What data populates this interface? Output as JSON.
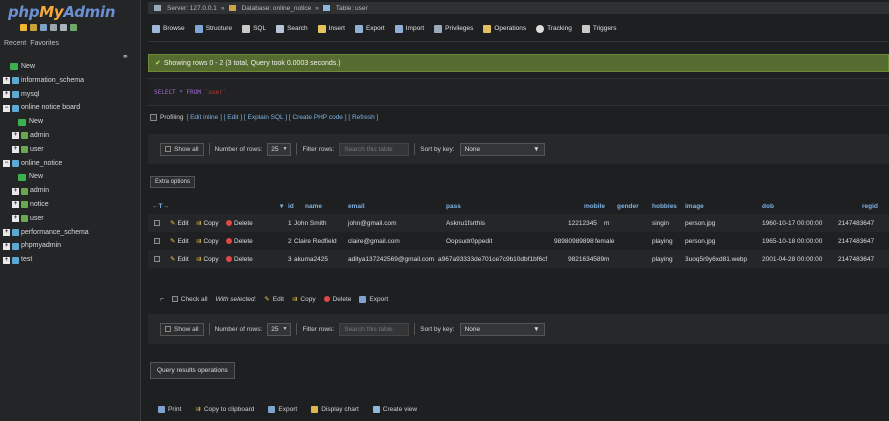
{
  "sidebar": {
    "logo": {
      "php": "php",
      "my": "My",
      "admin": "Admin"
    },
    "tabs": [
      "Recent",
      "Favorites"
    ],
    "collapse_icon": "chain-link-icon",
    "tree": [
      {
        "label": "New",
        "type": "new",
        "level": 0
      },
      {
        "label": "information_schema",
        "type": "db",
        "level": 0
      },
      {
        "label": "mysql",
        "type": "db",
        "level": 0
      },
      {
        "label": "online notice board",
        "type": "db",
        "level": 0
      },
      {
        "label": "New",
        "type": "new",
        "level": 1
      },
      {
        "label": "admin",
        "type": "table",
        "level": 1
      },
      {
        "label": "user",
        "type": "table",
        "level": 1
      },
      {
        "label": "online_notice",
        "type": "db",
        "level": 0
      },
      {
        "label": "New",
        "type": "new",
        "level": 1
      },
      {
        "label": "admin",
        "type": "table",
        "level": 1
      },
      {
        "label": "notice",
        "type": "table",
        "level": 1
      },
      {
        "label": "user",
        "type": "table",
        "level": 1
      },
      {
        "label": "performance_schema",
        "type": "db",
        "level": 0
      },
      {
        "label": "phpmyadmin",
        "type": "db",
        "level": 0
      },
      {
        "label": "test",
        "type": "db",
        "level": 0
      }
    ]
  },
  "breadcrumb": {
    "server": "Server: 127.0.0.1",
    "database": "Database: online_notice",
    "table": "Table: user"
  },
  "menu": [
    "Browse",
    "Structure",
    "SQL",
    "Search",
    "Insert",
    "Export",
    "Import",
    "Privileges",
    "Operations",
    "Tracking",
    "Triggers"
  ],
  "message": "Showing rows 0 - 2 (3 total, Query took 0.0003 seconds.)",
  "sql": {
    "keyword": "SELECT * FROM",
    "table": "`user`"
  },
  "profiling": {
    "label": "Profiling",
    "links": "[ Edit inline ] [ Edit ] [ Explain SQL ] [ Create PHP code ] [ Refresh ]"
  },
  "nav": {
    "show_all": "Show all",
    "rows_label": "Number of rows:",
    "rows_value": "25",
    "filter_label": "Filter rows:",
    "filter_placeholder": "Search this table",
    "sort_label": "Sort by key:",
    "sort_value": "None"
  },
  "extra_options": "Extra options",
  "table": {
    "headers": [
      "id",
      "name",
      "email",
      "pass",
      "mobile",
      "gender",
      "hobbies",
      "image",
      "dob",
      "regid"
    ],
    "actions": {
      "edit": "Edit",
      "copy": "Copy",
      "delete": "Delete"
    },
    "rows": [
      {
        "id": "1",
        "name": "John Smith",
        "email": "john@gmail.com",
        "pass": "Asknu1fsrthis",
        "mobile": "12212345",
        "gender": "m",
        "hobbies": "singin",
        "image": "person.jpg",
        "dob": "1960-10-17 00:00:00",
        "regid": "2147483647"
      },
      {
        "id": "2",
        "name": "Claire Redfield",
        "email": "claire@gmail.com",
        "pass": "Oopsudr0ppedit",
        "mobile": "98980989898",
        "gender": "female",
        "hobbies": "playing",
        "image": "person.jpg",
        "dob": "1965-10-18 00:00:00",
        "regid": "2147483647"
      },
      {
        "id": "3",
        "name": "akuma2425",
        "email": "aditya137242569@gmail.com",
        "pass": "a967a93333de701ce7c9b10dbf1bf6cf",
        "mobile": "9821634589",
        "gender": "m",
        "hobbies": "playing",
        "image": "3uoq5r9y6xd81.webp",
        "dob": "2001-04-28 00:00:00",
        "regid": "2147483647"
      }
    ]
  },
  "bulk": {
    "check_all": "Check all",
    "with_selected": "With selected:",
    "edit": "Edit",
    "copy": "Copy",
    "delete": "Delete",
    "export": "Export"
  },
  "query_results": "Query results operations",
  "bottom": {
    "print": "Print",
    "copy_clipboard": "Copy to clipboard",
    "export": "Export",
    "display_chart": "Display chart",
    "create_view": "Create view"
  }
}
